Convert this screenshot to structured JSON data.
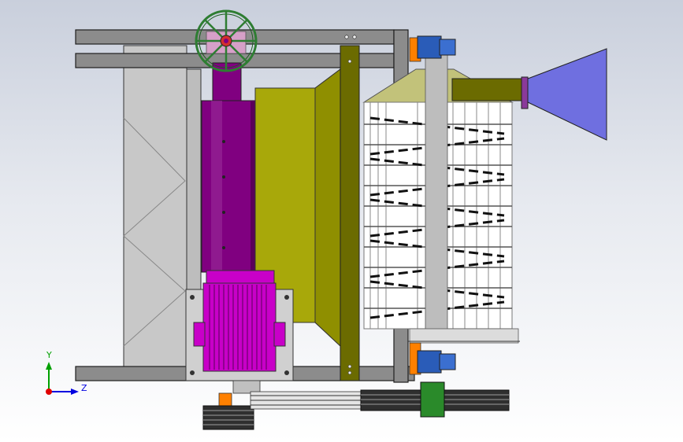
{
  "viewport": {
    "view_mode": "shaded-with-edges",
    "colors": {
      "frame": "#8c8c8c",
      "frame_edge": "#1e1e1e",
      "handwheel": "#2e7d32",
      "purple_column": "#800080",
      "motor_magenta": "#c800c8",
      "olive_guard": "#a8a80a",
      "olive_dark": "#6b6b00",
      "gray_panel": "#c8c8c8",
      "blue_gearbox": "#2a5cb8",
      "blue_funnel": "#6f6fe0",
      "drum_cage": "#ffffff",
      "drum_roof": "#c2c27a",
      "orange_part": "#ff8000",
      "green_pulley": "#2a8a2a"
    },
    "components": [
      {
        "name": "handwheel",
        "icon": "handwheel-icon"
      },
      {
        "name": "vertical-column",
        "icon": "column-icon"
      },
      {
        "name": "drive-motor",
        "icon": "motor-icon"
      },
      {
        "name": "rotary-drum-screen",
        "icon": "drum-icon"
      },
      {
        "name": "discharge-funnel",
        "icon": "funnel-icon"
      },
      {
        "name": "belt-drive",
        "icon": "belt-icon"
      }
    ]
  },
  "triad": {
    "y_label": "Y",
    "z_label": "Z",
    "x_color": "#e00000",
    "y_color": "#00a000",
    "z_color": "#0000e0"
  }
}
